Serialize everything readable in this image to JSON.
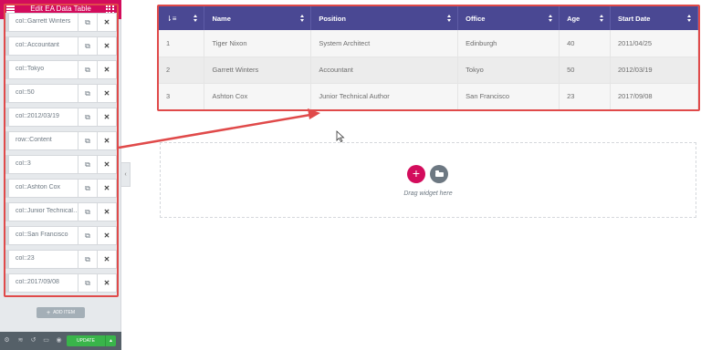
{
  "panel": {
    "title": "Edit EA Data Table",
    "items": [
      "col::Garrett Winters",
      "col::Accountant",
      "col::Tokyo",
      "col::50",
      "col::2012/03/19",
      "row::Content",
      "col::3",
      "col::Ashton Cox",
      "col::Junior Technical Author",
      "col::San Francisco",
      "col::23",
      "col::2017/09/08"
    ],
    "duplicate_icon": "copy-icon",
    "remove_icon": "close-icon",
    "add_item_label": "ADD ITEM",
    "footer": {
      "icons": [
        "gear-icon",
        "layers-icon",
        "history-icon",
        "responsive-icon",
        "eye-icon"
      ],
      "update_label": "UPDATE"
    }
  },
  "table": {
    "headers": [
      "",
      "Name",
      "Position",
      "Office",
      "Age",
      "Start Date"
    ],
    "rows": [
      [
        "1",
        "Tiger Nixon",
        "System Architect",
        "Edinburgh",
        "40",
        "2011/04/25"
      ],
      [
        "2",
        "Garrett Winters",
        "Accountant",
        "Tokyo",
        "50",
        "2012/03/19"
      ],
      [
        "3",
        "Ashton Cox",
        "Junior Technical Author",
        "San Francisco",
        "23",
        "2017/09/08"
      ]
    ],
    "header_color": "#4a4893"
  },
  "dropzone": {
    "text": "Drag widget here"
  },
  "colors": {
    "brand": "#d30c5c",
    "annotation": "#e04a4a",
    "update": "#39b54a"
  }
}
